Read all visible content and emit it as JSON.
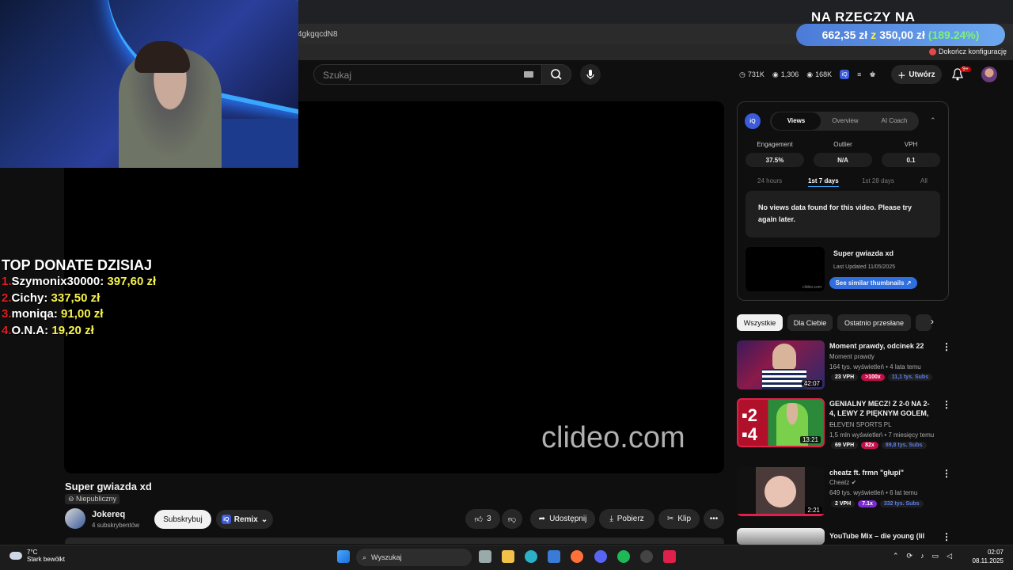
{
  "browser": {
    "url_fragment": "4gkgqcdN8",
    "config_link": "Dokończ konfigurację"
  },
  "donate_goal": {
    "title": "NA RZECZY NA PRZEDŁUŻANY",
    "current": "662,35 zł",
    "sep": "z",
    "target": "350,00 zł",
    "percent": "(189.24%)"
  },
  "top_donate": {
    "title": "TOP DONATE DZISIAJ",
    "rows": [
      {
        "num": "1.",
        "name": "Szymonix30000:",
        "amount": "397,60 zł"
      },
      {
        "num": "2.",
        "name": "Cichy:",
        "amount": "337,50 zł"
      },
      {
        "num": "3.",
        "name": "moniqa:",
        "amount": "91,00 zł"
      },
      {
        "num": "4.",
        "name": "O.N.A:",
        "amount": "19,20 zł"
      }
    ]
  },
  "header": {
    "search_placeholder": "Szukaj",
    "stats": {
      "views": "731K",
      "likes": "1,306",
      "subs": "168K"
    },
    "create_label": "Utwórz",
    "notif_badge": "9+"
  },
  "video": {
    "watermark": "clideo.com",
    "title": "Super gwiazda xd",
    "privacy": "Niepubliczny",
    "channel": "Jokereq",
    "subs": "4 subskrybentów",
    "subscribe": "Subskrybuj",
    "remix": "Remix",
    "likes": "3",
    "share": "Udostępnij",
    "download": "Pobierz",
    "clip": "Klip"
  },
  "vidiq": {
    "logo": "iQ",
    "tabs": [
      "Views",
      "Overview",
      "AI Coach"
    ],
    "metrics": [
      {
        "label": "Engagement",
        "value": "37.5%"
      },
      {
        "label": "Outlier",
        "value": "N/A"
      },
      {
        "label": "VPH",
        "value": "0.1"
      }
    ],
    "ranges": [
      "24 hours",
      "1st 7 days",
      "1st 28 days",
      "All"
    ],
    "no_data": "No views data found for this video. Please try again later.",
    "thumb_mark": "clideo.com",
    "video_title": "Super gwiazda xd",
    "updated": "Last Updated 11/05/2025",
    "similar": "See similar thumbnails ↗"
  },
  "chips": [
    "Wszystkie",
    "Dla Ciebie",
    "Ostatnio przesłane"
  ],
  "recs": [
    {
      "title": "Moment prawdy, odcinek 22",
      "channel": "Moment prawdy",
      "meta": "164 tys. wyświetleń • 4 lata temu",
      "duration": "42:07",
      "vph": "23 VPH",
      "mult": ">100x",
      "subs": "11,1 tys. Subs"
    },
    {
      "title": "GENIALNY MECZ! Z 2-0 NA 2-4, LEWY Z PIĘKNYM GOLEM, ...",
      "channel": "ELEVEN SPORTS PL",
      "meta": "1,5 mln wyświetleń • 7 miesięcy temu",
      "duration": "13:21",
      "vph": "69 VPH",
      "mult": "82x",
      "subs": "89,8 tys. Subs"
    },
    {
      "title": "cheatz ft. frmn \"głupi\"",
      "channel": "Cheatz",
      "meta": "649 tys. wyświetleń • 6 lat temu",
      "duration": "2:21",
      "vph": "2 VPH",
      "mult": "7.1x",
      "subs": "332 tys. Subs"
    },
    {
      "title": "YouTube Mix – die young (lil",
      "channel": "",
      "meta": "",
      "duration": "",
      "vph": "",
      "mult": "",
      "subs": ""
    }
  ],
  "taskbar": {
    "temp": "7°C",
    "weather": "Stark bewölkt",
    "search": "Wyszukaj",
    "time": "02:07",
    "date": "08.11.2025"
  },
  "colors": {
    "accent_blue": "#3ea6ff",
    "vidiq_blue": "#3b5bdb",
    "donate_red": "#e21d1d",
    "donate_yellow": "#f6f34a"
  }
}
